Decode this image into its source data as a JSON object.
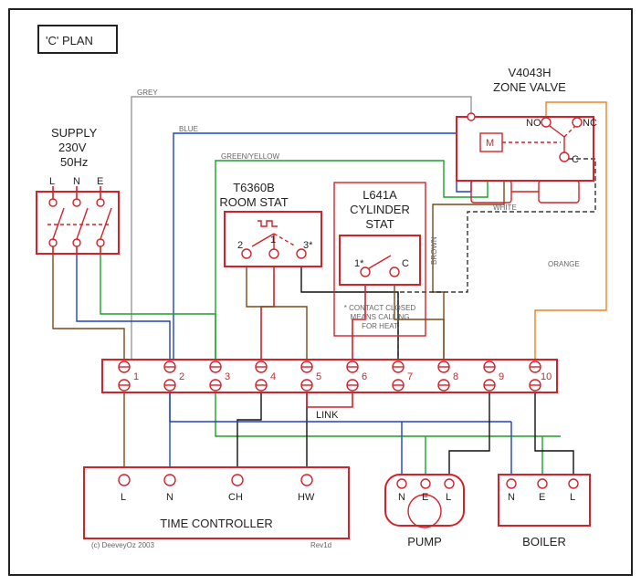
{
  "title": "'C' PLAN",
  "supply": {
    "label": "SUPPLY",
    "volt": "230V",
    "freq": "50Hz",
    "terms": [
      "L",
      "N",
      "E"
    ]
  },
  "roomstat": {
    "model": "T6360B",
    "name": "ROOM STAT",
    "terms": [
      "2",
      "1",
      "3*"
    ]
  },
  "cylstat": {
    "model": "L641A",
    "name": "CYLINDER",
    "name2": "STAT",
    "terms": [
      "1*",
      "C"
    ],
    "note1": "* CONTACT CLOSED",
    "note2": "MEANS CALLING",
    "note3": "FOR HEAT"
  },
  "zone": {
    "model": "V4043H",
    "name": "ZONE VALVE",
    "NO": "NO",
    "NC": "NC",
    "C": "C",
    "M": "M"
  },
  "junction": {
    "terms": [
      "1",
      "2",
      "3",
      "4",
      "5",
      "6",
      "7",
      "8",
      "9",
      "10"
    ],
    "link": "LINK"
  },
  "timectrl": {
    "name": "TIME CONTROLLER",
    "terms": [
      "L",
      "N",
      "CH",
      "HW"
    ]
  },
  "pump": {
    "name": "PUMP",
    "terms": [
      "N",
      "E",
      "L"
    ]
  },
  "boiler": {
    "name": "BOILER",
    "terms": [
      "N",
      "E",
      "L"
    ]
  },
  "wire_lbl": {
    "grey": "GREY",
    "blue": "BLUE",
    "gy": "GREEN/YELLOW",
    "brown": "BROWN",
    "white": "WHITE",
    "orange": "ORANGE"
  },
  "credit": "(c) DeeveyOz 2003",
  "rev": "Rev1d"
}
